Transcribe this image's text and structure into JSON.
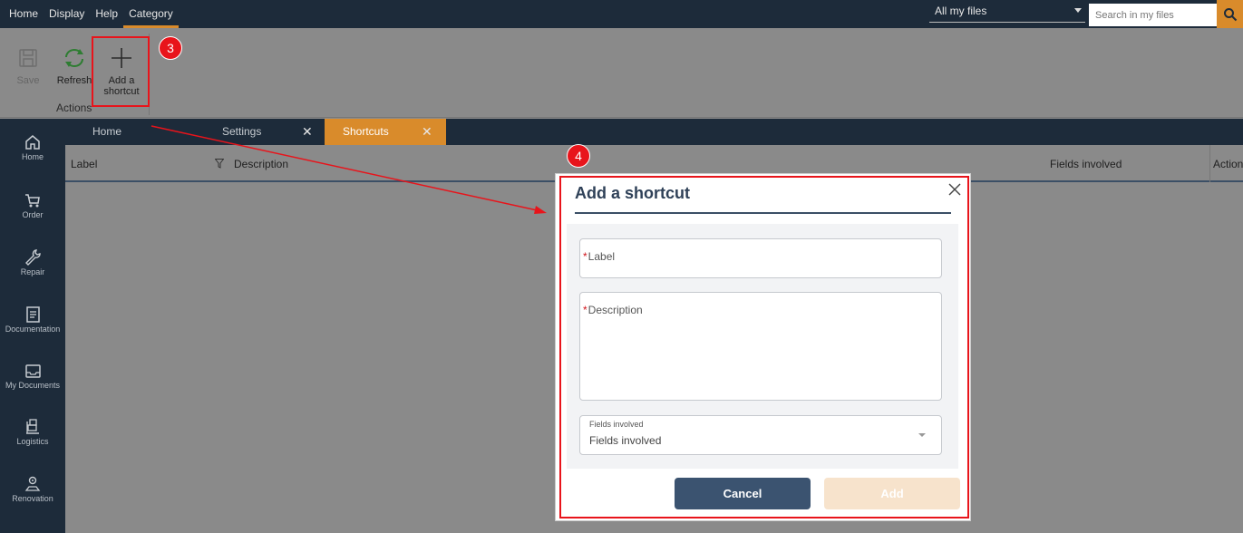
{
  "menu": {
    "items": [
      "Home",
      "Display",
      "Help",
      "Category"
    ],
    "active": "Category"
  },
  "search": {
    "scope": "All my files",
    "placeholder": "Search in my files"
  },
  "ribbon": {
    "save_label": "Save",
    "refresh_label": "Refresh",
    "add_shortcut_label_line1": "Add a",
    "add_shortcut_label_line2": "shortcut",
    "group_label": "Actions"
  },
  "annotations": {
    "step3": "3",
    "step4": "4",
    "color": "#e8141b"
  },
  "sidebar": {
    "items": [
      {
        "label": "Home",
        "icon": "home-icon"
      },
      {
        "label": "Order",
        "icon": "cart-icon"
      },
      {
        "label": "Repair",
        "icon": "wrench-icon"
      },
      {
        "label": "Documentation",
        "icon": "document-icon"
      },
      {
        "label": "My Documents",
        "icon": "inbox-icon"
      },
      {
        "label": "Logistics",
        "icon": "logistics-icon"
      },
      {
        "label": "Renovation",
        "icon": "renovation-icon"
      }
    ]
  },
  "tabs": [
    {
      "label": "Home",
      "closable": false
    },
    {
      "label": "Settings",
      "closable": true
    },
    {
      "label": "Shortcuts",
      "closable": true,
      "active": true
    }
  ],
  "grid": {
    "columns": [
      "Label",
      "Description",
      "Fields involved",
      "Actions"
    ]
  },
  "dialog": {
    "title": "Add a shortcut",
    "label_placeholder": "Label",
    "description_placeholder": "Description",
    "fields_label": "Fields involved",
    "fields_value": "Fields involved",
    "required_mark": "*",
    "cancel_label": "Cancel",
    "add_label": "Add"
  },
  "colors": {
    "navbar": "#1d2b3a",
    "accent": "#d98b2b",
    "overlay": "#8a8a8a",
    "primary_button": "#3b5370",
    "disabled_button": "#f7e3cc"
  }
}
